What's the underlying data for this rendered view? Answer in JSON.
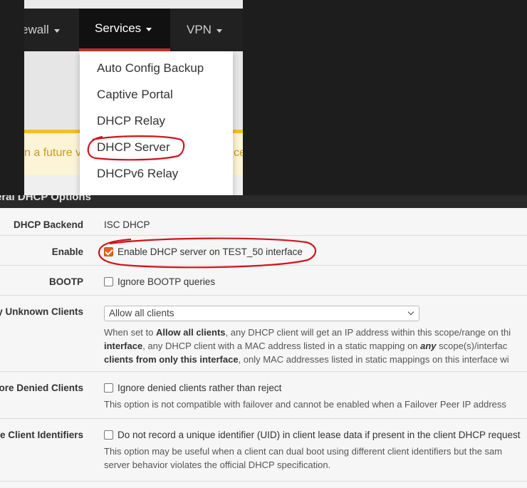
{
  "navbar": {
    "items": [
      {
        "label": "ewall"
      },
      {
        "label": "Services"
      },
      {
        "label": "VPN"
      }
    ]
  },
  "dropdown": {
    "items": [
      {
        "label": "Auto Config Backup"
      },
      {
        "label": "Captive Portal"
      },
      {
        "label": "DHCP Relay"
      },
      {
        "label": "DHCP Server"
      },
      {
        "label": "DHCPv6 Relay"
      }
    ]
  },
  "warning": {
    "left_text": "n a future v",
    "right_text": "ce"
  },
  "section": {
    "title": "eral DHCP Options"
  },
  "form": {
    "backend": {
      "label": "DHCP Backend",
      "value": "ISC DHCP"
    },
    "enable": {
      "label": "Enable",
      "checkbox_label": "Enable DHCP server on TEST_50 interface",
      "checked": true
    },
    "bootp": {
      "label": "BOOTP",
      "checkbox_label": "Ignore BOOTP queries",
      "checked": false
    },
    "unknown_clients": {
      "label": "ny Unknown Clients",
      "selected": "Allow all clients",
      "help_line1_pre": "When set to ",
      "help_line1_bold": "Allow all clients",
      "help_line1_post": ", any DHCP client will get an IP address within this scope/range on thi",
      "help_line2_bold": "interface",
      "help_line2_mid": ", any DHCP client with a MAC address listed in a static mapping on ",
      "help_line2_bold2": "any",
      "help_line2_post": " scope(s)/interfac",
      "help_line3_bold": "clients from only this interface",
      "help_line3_post": ", only MAC addresses listed in static mappings on this interface wi"
    },
    "denied_clients": {
      "label": "nore Denied Clients",
      "checkbox_label": "Ignore denied clients rather than reject",
      "checked": false,
      "help": "This option is not compatible with failover and cannot be enabled when a Failover Peer IP address"
    },
    "client_identifiers": {
      "label": "re Client Identifiers",
      "checkbox_label": "Do not record a unique identifier (UID) in client lease data if present in the client DHCP request",
      "checked": false,
      "help_line1": "This option may be useful when a client can dual boot using different client identifiers but the sam",
      "help_line2": "server behavior violates the official DHCP specification."
    }
  },
  "colors": {
    "navbar_bg": "#212121",
    "active_tab_border": "#c9302c",
    "checkbox_checked": "#e4631c",
    "annotation_red": "#d0141c",
    "warning_border": "#f0c21d"
  }
}
